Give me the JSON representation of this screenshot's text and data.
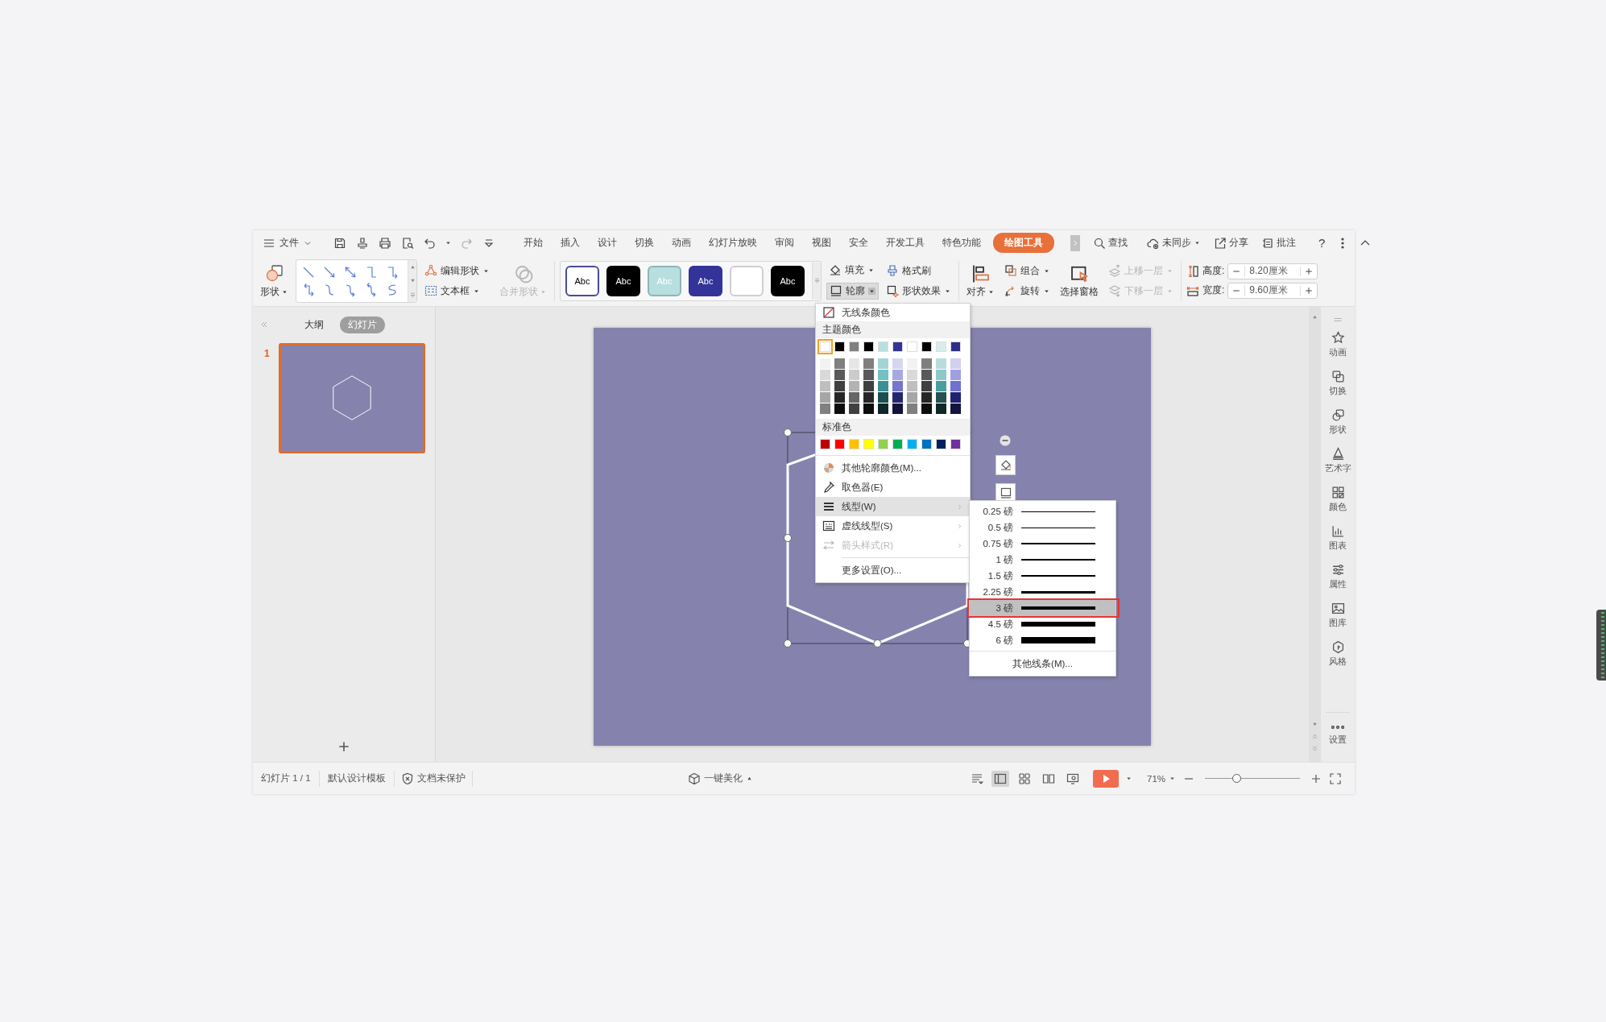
{
  "menu_bar": {
    "file_menu": "文件",
    "tabs": [
      {
        "label": "开始",
        "selected": false
      },
      {
        "label": "插入",
        "selected": false
      },
      {
        "label": "设计",
        "selected": false
      },
      {
        "label": "切换",
        "selected": false
      },
      {
        "label": "动画",
        "selected": false
      },
      {
        "label": "幻灯片放映",
        "selected": false
      },
      {
        "label": "审阅",
        "selected": false
      },
      {
        "label": "视图",
        "selected": false
      },
      {
        "label": "安全",
        "selected": false
      },
      {
        "label": "开发工具",
        "selected": false
      },
      {
        "label": "特色功能",
        "selected": false
      },
      {
        "label": "绘图工具",
        "selected": true
      }
    ],
    "search": "查找",
    "sync": "未同步",
    "share": "分享",
    "comment": "批注",
    "help": "?"
  },
  "ribbon": {
    "shapes": "形状",
    "edit_shape": "编辑形状",
    "text_box": "文本框",
    "merge_shapes": {
      "label": "合并形状",
      "disabled": true
    },
    "style_presets": [
      {
        "label": "Abc",
        "color": "#ffffff",
        "kind": "light"
      },
      {
        "label": "Abc",
        "color": "#000000",
        "kind": "dark"
      },
      {
        "label": "Abc",
        "color": "#b8dfe0",
        "kind": "tinted"
      },
      {
        "label": "Abc",
        "color": "#333399",
        "kind": "dark"
      },
      {
        "color": "#ffffff",
        "kind": "blank"
      },
      {
        "label": "Abc",
        "color": "#000000",
        "kind": "dark"
      }
    ],
    "fill": "填充",
    "outline": {
      "label": "轮廓",
      "open": true
    },
    "format_painter": "格式刷",
    "shape_effects": "形状效果",
    "align": "对齐",
    "group": "组合",
    "rotate": "旋转",
    "selection_pane": "选择窗格",
    "bring_forward": {
      "label": "上移一层",
      "disabled": true
    },
    "send_backward": {
      "label": "下移一层",
      "disabled": true
    },
    "height": {
      "label": "高度:",
      "value": "8.20厘米"
    },
    "width": {
      "label": "宽度:",
      "value": "9.60厘米"
    }
  },
  "slides_panel": {
    "tabs": [
      {
        "label": "大纲",
        "selected": false
      },
      {
        "label": "幻灯片",
        "selected": true
      }
    ],
    "slides": [
      {
        "number": "1",
        "selected": true
      }
    ]
  },
  "outline_menu": {
    "no_line": "无线条颜色",
    "theme_header": "主题颜色",
    "theme_colors": [
      {
        "color": "#ffffff",
        "selected": true
      },
      {
        "color": "#000000",
        "selected": false
      },
      {
        "color": "#808080",
        "selected": false
      },
      {
        "color": "#000000",
        "selected": false
      },
      {
        "color": "#b8dfe0",
        "selected": false
      },
      {
        "color": "#333399",
        "selected": false
      },
      {
        "color": "#ffffff",
        "selected": false
      },
      {
        "color": "#000000",
        "selected": false
      },
      {
        "color": "#d9ecec",
        "selected": false
      },
      {
        "color": "#2e2e8a",
        "selected": false
      }
    ],
    "shade_columns": [
      [
        {
          "color": "#f2f2f2"
        },
        {
          "color": "#d9d9d9"
        },
        {
          "color": "#bfbfbf"
        },
        {
          "color": "#a6a6a6"
        },
        {
          "color": "#808080"
        }
      ],
      [
        {
          "color": "#7f7f7f"
        },
        {
          "color": "#595959"
        },
        {
          "color": "#3f3f3f"
        },
        {
          "color": "#262626"
        },
        {
          "color": "#0d0d0d"
        }
      ],
      [
        {
          "color": "#e6e6e6"
        },
        {
          "color": "#cccccc"
        },
        {
          "color": "#b3b3b3"
        },
        {
          "color": "#666666"
        },
        {
          "color": "#404040"
        }
      ],
      [
        {
          "color": "#7f7f7f"
        },
        {
          "color": "#595959"
        },
        {
          "color": "#3f3f3f"
        },
        {
          "color": "#262626"
        },
        {
          "color": "#0d0d0d"
        }
      ],
      [
        {
          "color": "#a3d5d6"
        },
        {
          "color": "#74c0c2"
        },
        {
          "color": "#3a9093"
        },
        {
          "color": "#1f4e4f"
        },
        {
          "color": "#0f2728"
        }
      ],
      [
        {
          "color": "#d6d6f0"
        },
        {
          "color": "#a8a8e0"
        },
        {
          "color": "#7676d0"
        },
        {
          "color": "#262670"
        },
        {
          "color": "#13133a"
        }
      ],
      [
        {
          "color": "#f2f2f2"
        },
        {
          "color": "#d9d9d9"
        },
        {
          "color": "#bfbfbf"
        },
        {
          "color": "#a6a6a6"
        },
        {
          "color": "#808080"
        }
      ],
      [
        {
          "color": "#7f7f7f"
        },
        {
          "color": "#595959"
        },
        {
          "color": "#3f3f3f"
        },
        {
          "color": "#262626"
        },
        {
          "color": "#0d0d0d"
        }
      ],
      [
        {
          "color": "#b9dcdc"
        },
        {
          "color": "#8fc8c8"
        },
        {
          "color": "#4a9ea0"
        },
        {
          "color": "#265051"
        },
        {
          "color": "#122828"
        }
      ],
      [
        {
          "color": "#d0d0f0"
        },
        {
          "color": "#a0a0e0"
        },
        {
          "color": "#7070d0"
        },
        {
          "color": "#222270"
        },
        {
          "color": "#141440"
        }
      ]
    ],
    "standard_header": "标准色",
    "standard_colors": [
      {
        "color": "#c00000"
      },
      {
        "color": "#ff0000"
      },
      {
        "color": "#ffc000"
      },
      {
        "color": "#ffff00"
      },
      {
        "color": "#92d050"
      },
      {
        "color": "#00b050"
      },
      {
        "color": "#00b0f0"
      },
      {
        "color": "#0070c0"
      },
      {
        "color": "#002060"
      },
      {
        "color": "#7030a0"
      }
    ],
    "items": [
      {
        "label": "其他轮廓颜色(M)...",
        "kind": "palette",
        "submenu": false,
        "disabled": false,
        "highlighted": false
      },
      {
        "label": "取色器(E)",
        "kind": "eyedropper",
        "submenu": false,
        "disabled": false,
        "highlighted": false
      },
      {
        "label": "线型(W)",
        "kind": "lines",
        "submenu": true,
        "disabled": false,
        "highlighted": true
      },
      {
        "label": "虚线线型(S)",
        "kind": "dashes",
        "submenu": true,
        "disabled": false,
        "highlighted": false
      },
      {
        "label": "箭头样式(R)",
        "kind": "arrows",
        "submenu": true,
        "disabled": true,
        "highlighted": false
      },
      {
        "label": "更多设置(O)...",
        "kind": "plain",
        "submenu": false,
        "disabled": false,
        "highlighted": false
      }
    ]
  },
  "line_weight_menu": {
    "items": [
      {
        "label": "0.25 磅",
        "selected": false,
        "marked": false
      },
      {
        "label": "0.5 磅",
        "selected": false,
        "marked": false
      },
      {
        "label": "0.75 磅",
        "selected": false,
        "marked": false
      },
      {
        "label": "1 磅",
        "selected": false,
        "marked": false
      },
      {
        "label": "1.5 磅",
        "selected": false,
        "marked": false
      },
      {
        "label": "2.25 磅",
        "selected": false,
        "marked": false
      },
      {
        "label": "3 磅",
        "selected": true,
        "marked": true
      },
      {
        "label": "4.5 磅",
        "selected": false,
        "marked": false
      },
      {
        "label": "6 磅",
        "selected": false,
        "marked": false
      }
    ],
    "more": "其他线条(M)..."
  },
  "right_sidebar": {
    "items": [
      {
        "label": "动画",
        "kind": "animation"
      },
      {
        "label": "切换",
        "kind": "transition"
      },
      {
        "label": "形状",
        "kind": "shape"
      },
      {
        "label": "艺术字",
        "kind": "wordart"
      },
      {
        "label": "颜色",
        "kind": "color"
      },
      {
        "label": "图表",
        "kind": "chart"
      },
      {
        "label": "属性",
        "kind": "properties"
      },
      {
        "label": "图库",
        "kind": "gallery"
      },
      {
        "label": "风格",
        "kind": "style"
      }
    ],
    "settings": "设置"
  },
  "status_bar": {
    "slide_count": "幻灯片 1 / 1",
    "template": "默认设计模板",
    "protection": "文档未保护",
    "beautify": "一键美化",
    "views": [
      {
        "kind": "normal",
        "selected": true
      },
      {
        "kind": "sorter",
        "selected": false
      },
      {
        "kind": "reading",
        "selected": false
      },
      {
        "kind": "presenter",
        "selected": false
      }
    ],
    "zoom": "71%",
    "zoom_slider": {
      "level": 0.32
    }
  }
}
